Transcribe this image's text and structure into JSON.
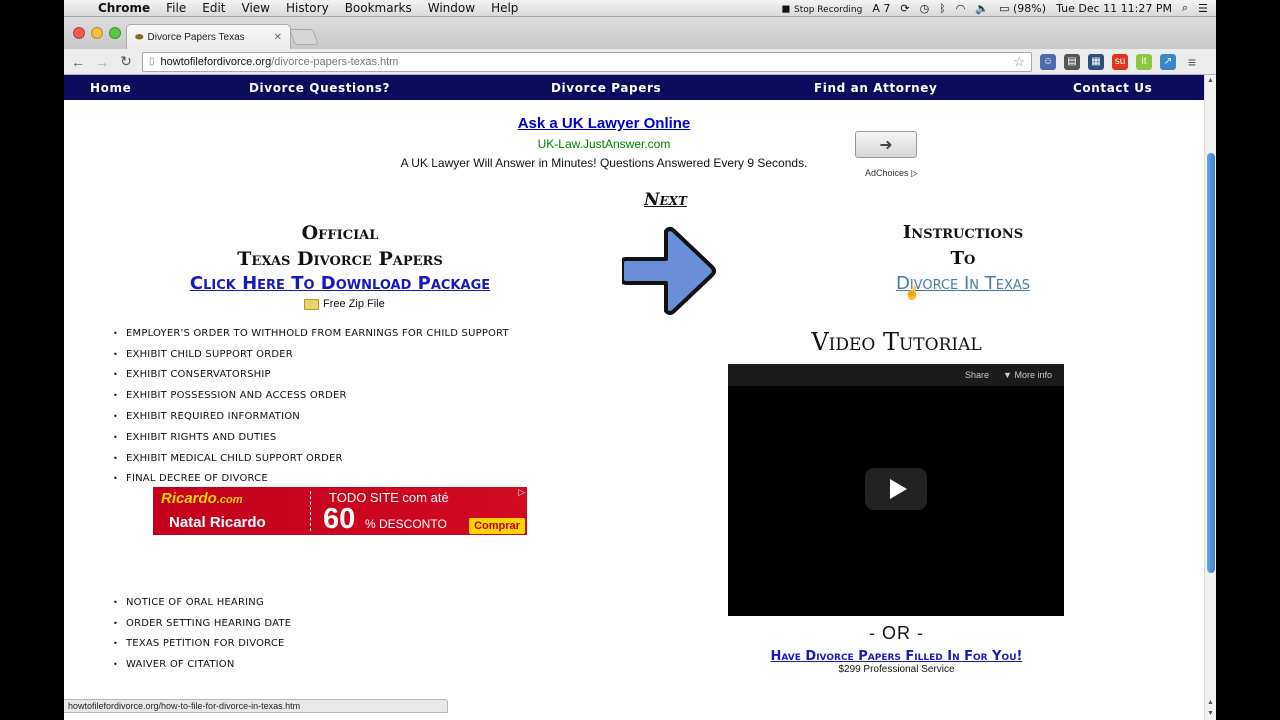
{
  "menubar": {
    "app": "Chrome",
    "menus": [
      "File",
      "Edit",
      "View",
      "History",
      "Bookmarks",
      "Window",
      "Help"
    ],
    "stop_recording": "Stop Recording",
    "notif_count": "7",
    "battery": "(98%)",
    "clock": "Tue Dec 11  11:27 PM"
  },
  "browser": {
    "tab_title": "Divorce Papers Texas",
    "url_domain": "howtofilefordivorce.org",
    "url_path": "/divorce-papers-texas.htm",
    "status_url": "howtofilefordivorce.org/how-to-file-for-divorce-in-texas.htm"
  },
  "sitenav": [
    "Home",
    "Divorce Questions?",
    "Divorce Papers",
    "Find an Attorney",
    "Contact Us"
  ],
  "ad": {
    "title": "Ask a UK Lawyer Online",
    "url": "UK-Law.JustAnswer.com",
    "description": "A UK Lawyer Will Answer in Minutes! Questions Answered Every 9 Seconds.",
    "adchoices": "AdChoices"
  },
  "next_label": "Next",
  "left": {
    "title_line1": "Official",
    "title_line2": "Texas Divorce Papers",
    "download_link": "Click Here To Download Package",
    "zip_label": "Free Zip File",
    "documents_a": [
      "EMPLOYER'S ORDER TO WITHHOLD FROM EARNINGS FOR CHILD SUPPORT",
      "EXHIBIT CHILD SUPPORT ORDER",
      "EXHIBIT CONSERVATORSHIP",
      "EXHIBIT POSSESSION AND ACCESS ORDER",
      "EXHIBIT REQUIRED INFORMATION",
      "EXHIBIT RIGHTS AND DUTIES",
      "EXHIBIT MEDICAL CHILD SUPPORT ORDER",
      "FINAL DECREE OF DIVORCE"
    ],
    "documents_b": [
      "NOTICE OF ORAL HEARING",
      "ORDER SETTING HEARING DATE",
      "TEXAS PETITION FOR DIVORCE",
      "WAIVER OF CITATION"
    ]
  },
  "banner": {
    "logo_top": "Ricardo",
    "logo_sub": ".com",
    "logo_bottom": "Natal Ricardo",
    "line1": "TODO SITE com até",
    "big": "60",
    "line3": "% DESCONTO",
    "button": "Comprar"
  },
  "right": {
    "title_line1": "Instructions",
    "title_line2": "To",
    "link": "Divorce In Texas",
    "video_title": "Video Tutorial",
    "video_share": "Share",
    "video_more": "More info",
    "or_text": "- OR -",
    "filled_link": "Have Divorce Papers Filled In For You!",
    "price": "$299 Professional Service"
  }
}
